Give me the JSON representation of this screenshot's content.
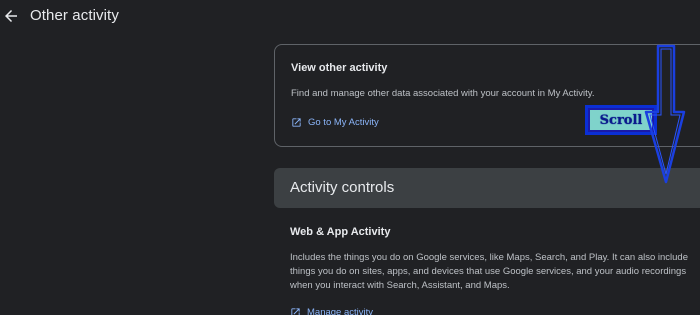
{
  "header": {
    "title": "Other activity",
    "back_icon": "arrow-back-icon"
  },
  "view_other_activity": {
    "title": "View other activity",
    "description": "Find and manage other data associated with your account in My Activity.",
    "link_label": "Go to My Activity",
    "link_icon": "open-in-new-icon"
  },
  "activity_controls": {
    "title": "Activity controls"
  },
  "web_app_activity": {
    "title": "Web & App Activity",
    "description": "Includes the things you do on Google services, like Maps, Search, and Play. It can also include things you do on sites, apps, and devices that use Google services, and your audio recordings when you interact with Search, Assistant, and Maps.",
    "link_label": "Manage activity",
    "link_icon": "open-in-new-icon"
  },
  "annotation": {
    "scroll_label": "Scroll",
    "arrow_icon": "down-arrow-icon"
  },
  "colors": {
    "background": "#202124",
    "surface": "#3c4043",
    "link": "#8ab4f8",
    "annotation_blue": "#0b2fd6",
    "annotation_fill": "#7fd3cb"
  }
}
